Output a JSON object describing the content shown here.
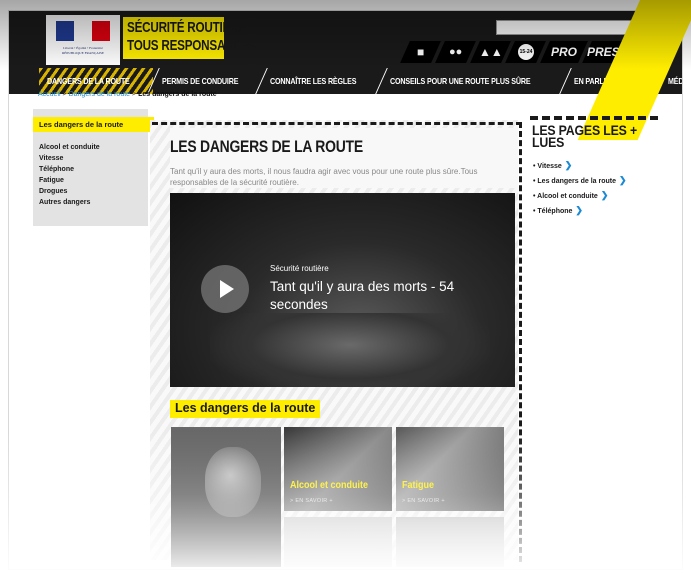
{
  "header": {
    "republic_text": "Liberté • Égalité • Fraternité RÉPUBLIQUE FRANÇAISE",
    "brand_line1": "SÉCURITÉ ROUTIÈRE",
    "brand_line2": "TOUS RESPONSABLES",
    "search_placeholder": "",
    "quicklinks": [
      {
        "name": "car-icon",
        "glyph": "🚗"
      },
      {
        "name": "motorcycle-icon",
        "glyph": "🏍"
      },
      {
        "name": "pedestrians-icon",
        "glyph": "🚶"
      },
      {
        "name": "age-15-24-icon",
        "glyph": "15-24"
      }
    ],
    "pro_label": "PRO",
    "presse_label": "PRESSE",
    "flag_colors": [
      "#1f3a93",
      "#ffffff",
      "#e1000f"
    ]
  },
  "nav": {
    "items": [
      {
        "label": "DANGERS DE LA ROUTE",
        "active": true
      },
      {
        "label": "PERMIS DE CONDUIRE"
      },
      {
        "label": "CONNAÎTRE LES RÈGLES"
      },
      {
        "label": "CONSEILS POUR UNE ROUTE PLUS SÛRE"
      },
      {
        "label": "EN PARLER & AGIR"
      },
      {
        "label": "MÉDIAS"
      }
    ]
  },
  "breadcrumb": {
    "home": "Accueil",
    "parent": "Dangers de la route",
    "current": "Les dangers de la route"
  },
  "sidebar": {
    "active": "Les dangers de la route",
    "items": [
      "Alcool et conduite",
      "Vitesse",
      "Téléphone",
      "Fatigue",
      "Drogues",
      "Autres dangers"
    ]
  },
  "main": {
    "title": "LES DANGERS DE LA ROUTE",
    "intro": "Tant qu'il y aura des morts, il nous faudra agir avec vous pour une route plus sûre.Tous responsables de la sécurité routière.",
    "video_channel": "Sécurité routière",
    "video_title": "Tant qu'il y aura des morts - 54 secondes",
    "section_title": "Les dangers de la route",
    "tiles": [
      {
        "label": "Alcool et conduite",
        "more": "> EN SAVOIR +"
      },
      {
        "label": "Fatigue",
        "more": "> EN SAVOIR +"
      }
    ]
  },
  "right": {
    "title": "LES PAGES LES + LUES",
    "items": [
      "Vitesse",
      "Les dangers de la route",
      "Alcool et conduite",
      "Téléphone"
    ]
  },
  "colors": {
    "brand_yellow": "#ffed00",
    "dark": "#1a1a1a",
    "link_blue": "#1a8ad4"
  }
}
